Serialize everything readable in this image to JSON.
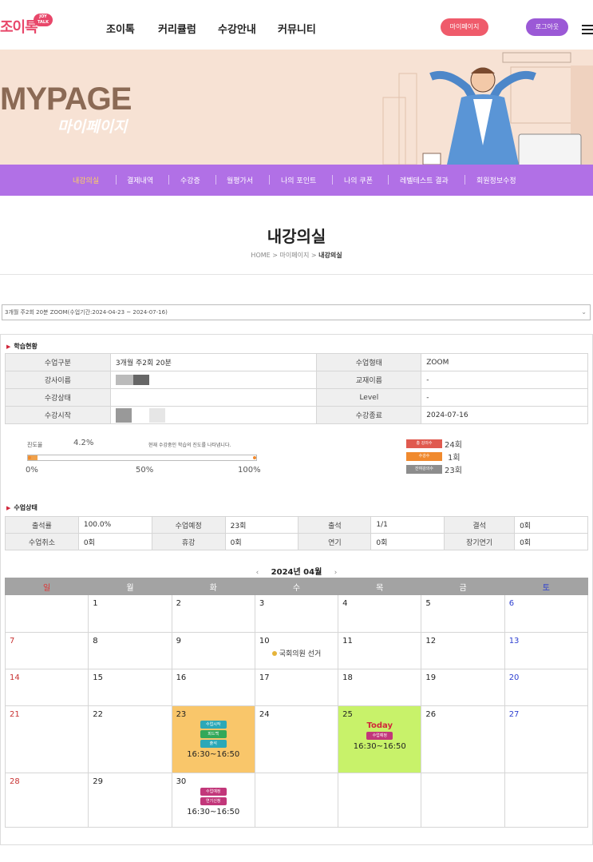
{
  "header": {
    "logo_text": "조이톡",
    "logo_badge": "JOY TALK",
    "nav": [
      "조이톡",
      "커리큘럼",
      "수강안내",
      "커뮤니티"
    ],
    "mypage_button": "마이페이지",
    "logout_button": "로그아웃"
  },
  "banner": {
    "title": "MYPAGE",
    "subtitle": "마이페이지"
  },
  "subnav": {
    "items": [
      "내강의실",
      "결제내역",
      "수강증",
      "월평가서",
      "나의 포인트",
      "나의 쿠폰",
      "레벨테스트 결과",
      "회원정보수정"
    ],
    "active_index": 0
  },
  "page": {
    "title": "내강의실",
    "breadcrumb": [
      "HOME",
      "마이페이지",
      "내강의실"
    ]
  },
  "course_select": {
    "value": "3개월 주2회 20분 ZOOM(수업기간:2024-04-23 ~ 2024-07-16)"
  },
  "learning_status": {
    "heading": "학습현황",
    "rows": [
      [
        "수업구분",
        "3개월 주2회 20분",
        "수업형태",
        "ZOOM"
      ],
      [
        "강사이름",
        "",
        "교재이름",
        "-"
      ],
      [
        "수강상태",
        "",
        "Level",
        "-"
      ],
      [
        "수강시작",
        "",
        "수강종료",
        "2024-07-16"
      ]
    ]
  },
  "progress": {
    "label": "진도율",
    "value_text": "4.2%",
    "value": 4.2,
    "note": "현재 수강중인 학습의 진도를 나타냅니다.",
    "ticks": [
      "0%",
      "50%",
      "100%"
    ],
    "counts": [
      {
        "label": "총 강의수",
        "value": "24회",
        "color": "#e05a4f"
      },
      {
        "label": "수강수",
        "value": "1회",
        "color": "#f08a2e"
      },
      {
        "label": "잔여강의수",
        "value": "23회",
        "color": "#8d8d8d"
      }
    ]
  },
  "class_status": {
    "heading": "수업상태",
    "rows": [
      [
        "출석률",
        "100.0%",
        "수업예정",
        "23회",
        "출석",
        "1/1",
        "결석",
        "0회"
      ],
      [
        "수업취소",
        "0회",
        "휴강",
        "0회",
        "연기",
        "0회",
        "장기연기",
        "0회"
      ]
    ]
  },
  "calendar": {
    "month_label": "2024년 04월",
    "prev": "‹",
    "next": "›",
    "weekdays": [
      "일",
      "월",
      "화",
      "수",
      "목",
      "금",
      "토"
    ],
    "holiday_label": "국회의원 선거",
    "today_label": "Today",
    "events": {
      "d23": [
        "수업시작",
        "피드백",
        "출석"
      ],
      "d25": [
        "수업예정"
      ],
      "d30": [
        "수업예정",
        "연기신청"
      ]
    },
    "event_colors": {
      "수업시작": "#2ca8b8",
      "피드백": "#32a85a",
      "출석": "#2ca8b8",
      "수업예정": "#c2377a",
      "연기신청": "#c2377a"
    },
    "lesson_time": "16:30~16:50"
  }
}
